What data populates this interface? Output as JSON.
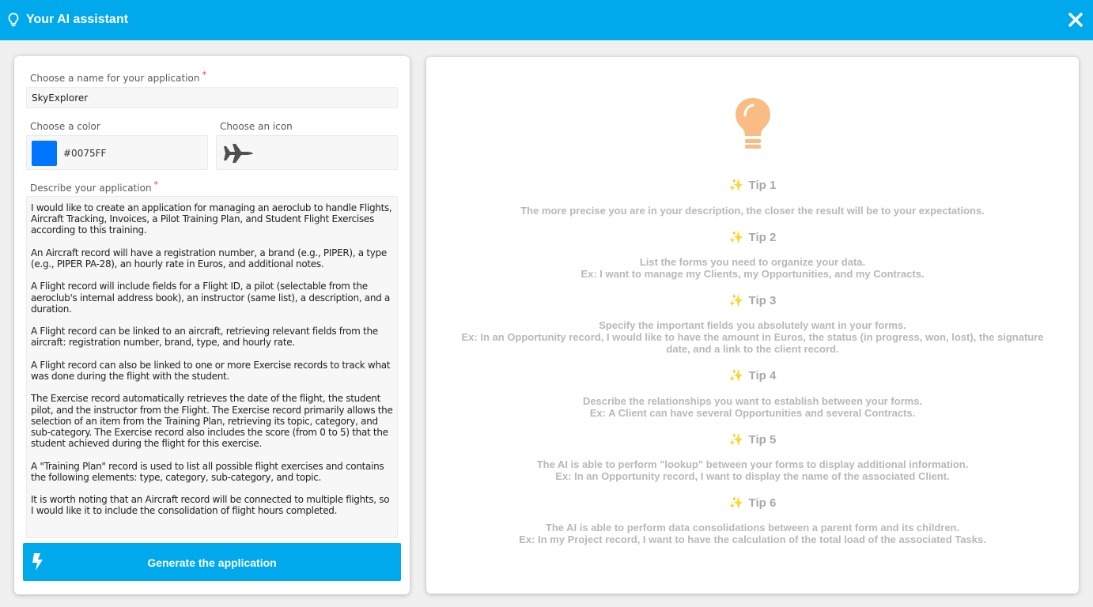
{
  "header": {
    "title": "Your AI assistant",
    "background": "#00a8ec"
  },
  "form": {
    "name_label": "Choose a name for your application",
    "required_mark": "*",
    "name_value": "SkyExplorer",
    "color_label": "Choose a color",
    "color_value": "#0075FF",
    "icon_label": "Choose an icon",
    "icon_name": "fighter-jet-icon",
    "description_label": "Describe your application",
    "description_value": "I would like to create an application for managing an aeroclub to handle Flights, Aircraft Tracking, Invoices, a Pilot Training Plan, and Student Flight Exercises according to this training.\n\nAn Aircraft record will have a registration number, a brand (e.g., PIPER), a type (e.g., PIPER PA-28), an hourly rate in Euros, and additional notes.\n\nA Flight record will include fields for a Flight ID, a pilot (selectable from the aeroclub's internal address book), an instructor (same list), a description, and a duration.\n\nA Flight record can be linked to an aircraft, retrieving relevant fields from the aircraft: registration number, brand, type, and hourly rate.\n\nA Flight record can also be linked to one or more Exercise records to track what was done during the flight with the student.\n\nThe Exercise record automatically retrieves the date of the flight, the student pilot, and the instructor from the Flight. The Exercise record primarily allows the selection of an item from the Training Plan, retrieving its topic, category, and sub-category. The Exercise record also includes the score (from 0 to 5) that the student achieved during the flight for this exercise.\n\nA \"Training Plan\" record is used to list all possible flight exercises and contains the following elements: type, category, sub-category, and topic.\n\nIt is worth noting that an Aircraft record will be connected to multiple flights, so I would like it to include the consolidation of flight hours completed.",
    "generate_label": "Generate the application"
  },
  "tips": [
    {
      "title": "Tip 1",
      "lines": [
        "The more precise you are in your description, the closer the result will be to your expectations."
      ]
    },
    {
      "title": "Tip 2",
      "lines": [
        "List the forms you need to organize your data.",
        "Ex: I want to manage my Clients, my Opportunities, and my Contracts."
      ]
    },
    {
      "title": "Tip 3",
      "lines": [
        "Specify the important fields you absolutely want in your forms.",
        "Ex: In an Opportunity record, I would like to have the amount in Euros, the status (in progress, won, lost), the signature date, and a link to the client record."
      ]
    },
    {
      "title": "Tip 4",
      "lines": [
        "Describe the relationships you want to establish between your forms.",
        "Ex: A Client can have several Opportunities and several Contracts."
      ]
    },
    {
      "title": "Tip 5",
      "lines": [
        "The AI is able to perform \"lookup\" between your forms to display additional information.",
        "Ex: In an Opportunity record, I want to display the name of the associated Client."
      ]
    },
    {
      "title": "Tip 6",
      "lines": [
        "The AI is able to perform data consolidations between a parent form and its children.",
        "Ex: In my Project record, I want to have the calculation of the total load of the associated Tasks."
      ]
    }
  ],
  "colors": {
    "accent": "#00a8ec",
    "bulb": "#f9bc84",
    "sparkle": "#f5c64a"
  }
}
